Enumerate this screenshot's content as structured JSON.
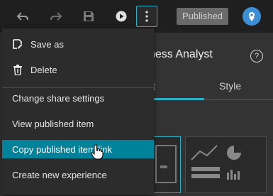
{
  "toolbar": {
    "published_label": "Published",
    "icons": [
      "undo-icon",
      "redo-icon",
      "save-icon",
      "play-icon",
      "more-vertical-icon"
    ],
    "accent_color": "#2bb0c8"
  },
  "panel": {
    "title_partial": "ness Analyst",
    "tabs": {
      "partial": "t",
      "style": "Style"
    }
  },
  "menu": {
    "save_as": "Save as",
    "delete": "Delete",
    "change_share": "Change share settings",
    "view_published": "View published item",
    "copy_link": "Copy published item link",
    "create_new": "Create new experience",
    "highlight_color": "#00829b"
  }
}
